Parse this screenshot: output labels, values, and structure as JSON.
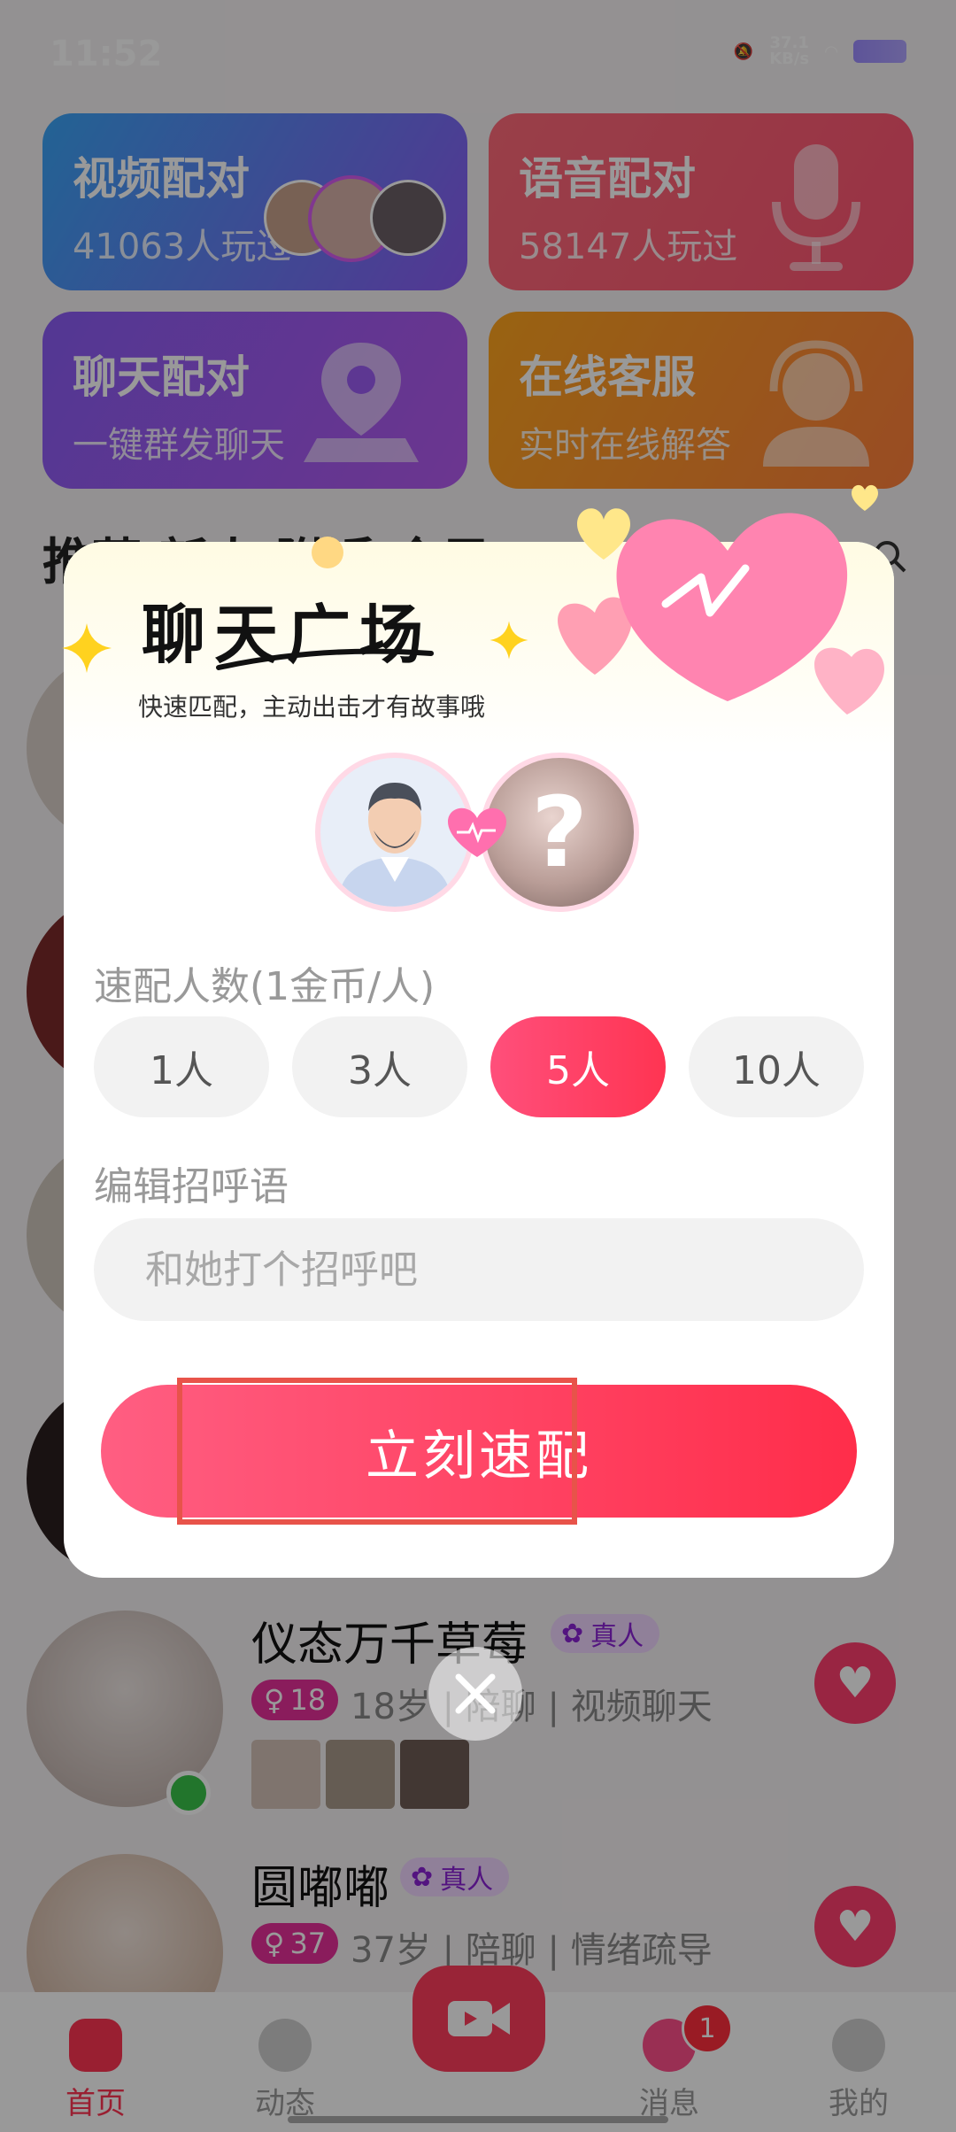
{
  "status_bar": {
    "time": "11:52",
    "net_speed": "37.1\nKB/s"
  },
  "features": [
    {
      "title": "视频配对",
      "subtitle": "41063人玩过"
    },
    {
      "title": "语音配对",
      "subtitle": "58147人玩过"
    },
    {
      "title": "聊天配对",
      "subtitle": "一键群发聊天"
    },
    {
      "title": "在线客服",
      "subtitle": "实时在线解答"
    }
  ],
  "tabs_partial": "推荐  新人  附近  全局",
  "users": [
    {
      "name": "仪态万千草莓",
      "badge": "真人",
      "age_tag": "18",
      "info": "18岁 | 陪聊 | 视频聊天"
    },
    {
      "name": "圆嘟嘟",
      "badge": "真人",
      "age_tag": "37",
      "info": "37岁 | 陪聊 | 情绪疏导"
    }
  ],
  "bottom_nav": [
    {
      "label": "首页",
      "active": true
    },
    {
      "label": "动态"
    },
    {
      "label": ""
    },
    {
      "label": "消息",
      "badge": "1"
    },
    {
      "label": "我的"
    }
  ],
  "dialog": {
    "title": "聊天广场",
    "subtitle": "快速匹配，主动出击才有故事哦",
    "unknown_mark": "?",
    "count_label": "速配人数(1金币/人)",
    "count_options": [
      "1人",
      "3人",
      "5人",
      "10人"
    ],
    "selected_count": "5人",
    "greeting_label": "编辑招呼语",
    "greeting_placeholder": "和她打个招呼吧",
    "match_button": "立刻速配"
  },
  "colors": {
    "accent": "#ff3452",
    "badge_purple": "#8a22d6",
    "age_pink": "#e6309a"
  }
}
